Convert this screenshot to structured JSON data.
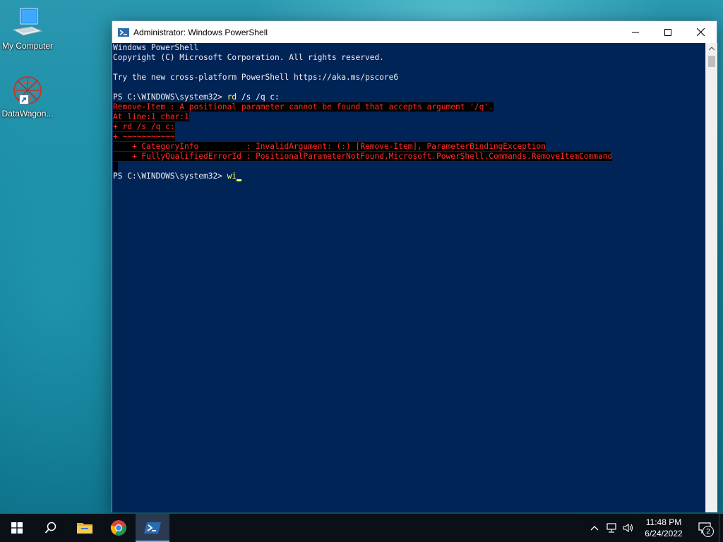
{
  "desktop": {
    "icons": [
      {
        "label": "My Computer",
        "icon": "computer-icon"
      },
      {
        "label": "DataWagon...",
        "icon": "datawagon-shortcut-icon"
      }
    ]
  },
  "window": {
    "title": "Administrator: Windows PowerShell",
    "icon": "powershell-icon",
    "controls": {
      "minimize": "—",
      "maximize": "☐",
      "close": "✕"
    }
  },
  "console": {
    "header": [
      "Windows PowerShell",
      "Copyright (C) Microsoft Corporation. All rights reserved.",
      "",
      "Try the new cross-platform PowerShell https://aka.ms/pscore6",
      ""
    ],
    "prompt1": "PS C:\\WINDOWS\\system32> ",
    "cmd1_name": "rd",
    "cmd1_args": " /s /q c:",
    "errors": [
      "Remove-Item : A positional parameter cannot be found that accepts argument '/q'.",
      "At line:1 char:1",
      "+ rd /s /q c:",
      "+ ~~~~~~~~~~~",
      "    + CategoryInfo          : InvalidArgument: (:) [Remove-Item], ParameterBindingException",
      "    + FullyQualifiedErrorId : PositionalParameterNotFound,Microsoft.PowerShell.Commands.RemoveItemCommand"
    ],
    "prompt2": "PS C:\\WINDOWS\\system32> ",
    "typed": "wi",
    "colors": {
      "background": "#012456",
      "text": "#eeedf0",
      "command": "#ffff60",
      "error": "#ff2a2a"
    }
  },
  "taskbar": {
    "items": [
      {
        "name": "start",
        "icon": "windows-logo-icon"
      },
      {
        "name": "search",
        "icon": "search-icon"
      },
      {
        "name": "file-explorer",
        "icon": "folder-icon"
      },
      {
        "name": "chrome",
        "icon": "chrome-icon"
      },
      {
        "name": "powershell",
        "icon": "powershell-icon",
        "active": true
      }
    ],
    "tray": {
      "time": "11:48 PM",
      "date": "6/24/2022",
      "notification_count": "2"
    }
  }
}
